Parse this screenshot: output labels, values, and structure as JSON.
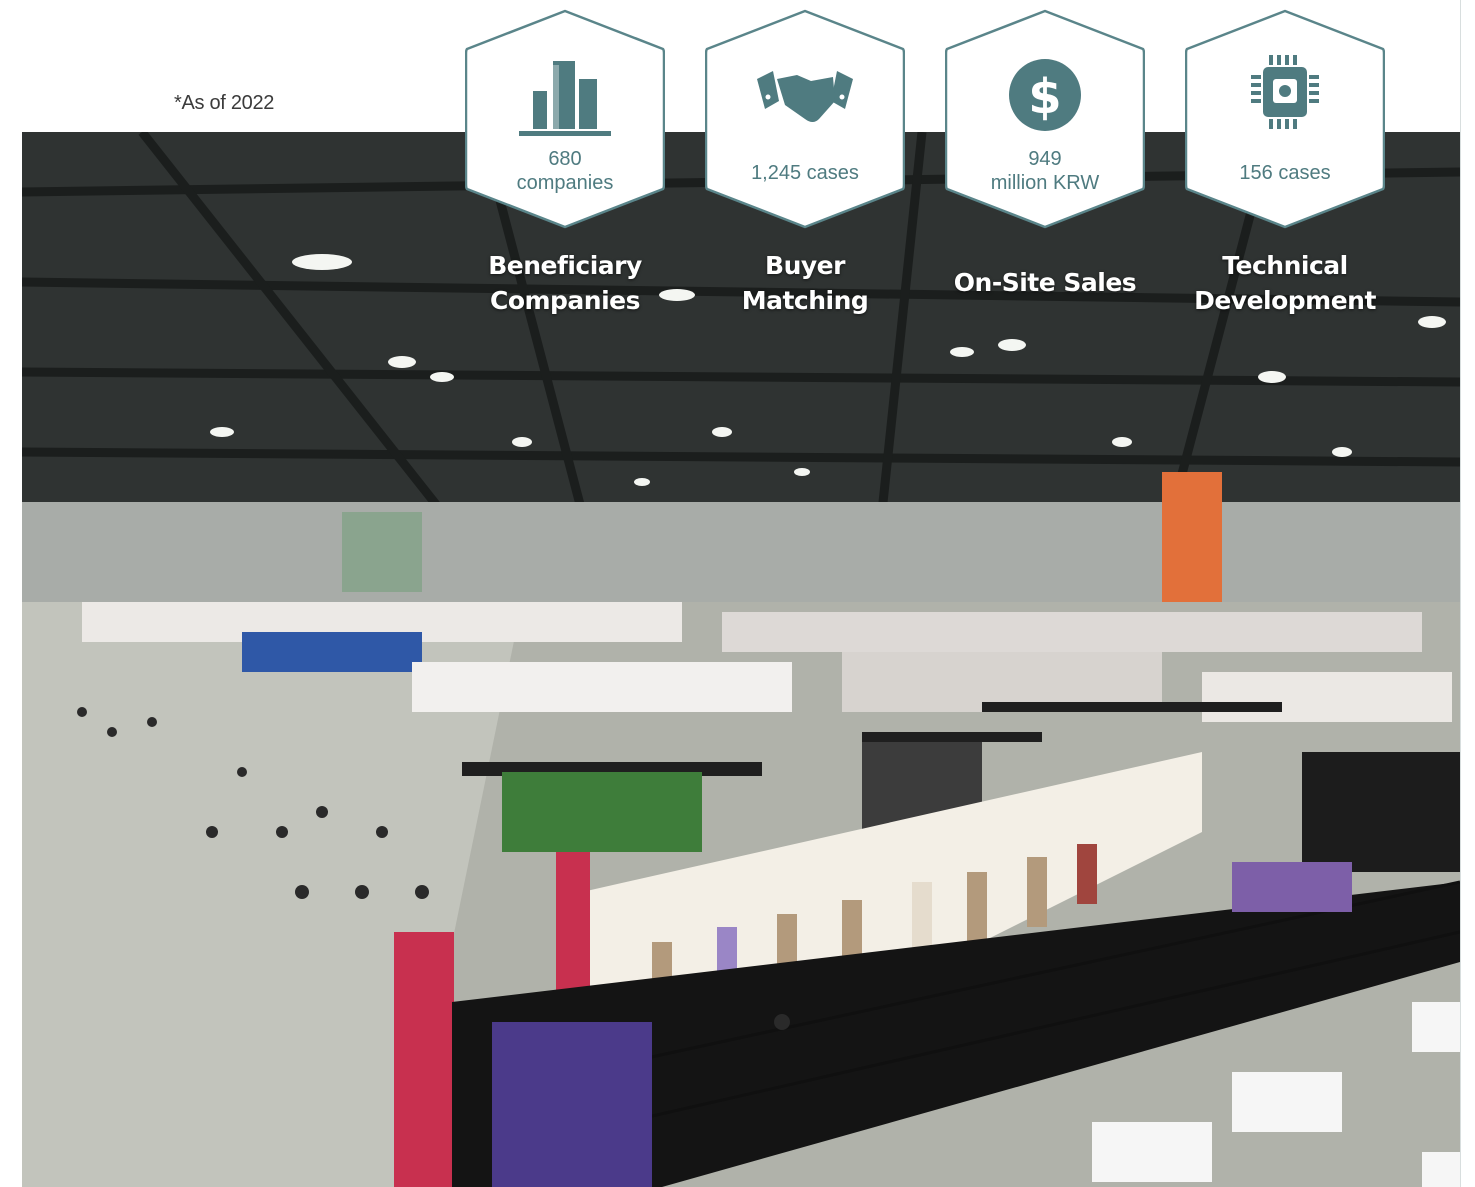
{
  "note": "*As of 2022",
  "stats": [
    {
      "icon": "buildings-icon",
      "value": "680\ncompanies",
      "label": "Beneficiary\nCompanies"
    },
    {
      "icon": "handshake-icon",
      "value": "1,245 cases",
      "label": "Buyer\nMatching"
    },
    {
      "icon": "dollar-coin-icon",
      "value": "949\nmillion KRW",
      "label": "On-Site Sales"
    },
    {
      "icon": "chip-icon",
      "value": "156 cases",
      "label": "Technical\nDevelopment"
    }
  ],
  "colors": {
    "accent": "#4f7b80",
    "hex_border": "#5a858a",
    "hex_fill": "#ffffff"
  }
}
